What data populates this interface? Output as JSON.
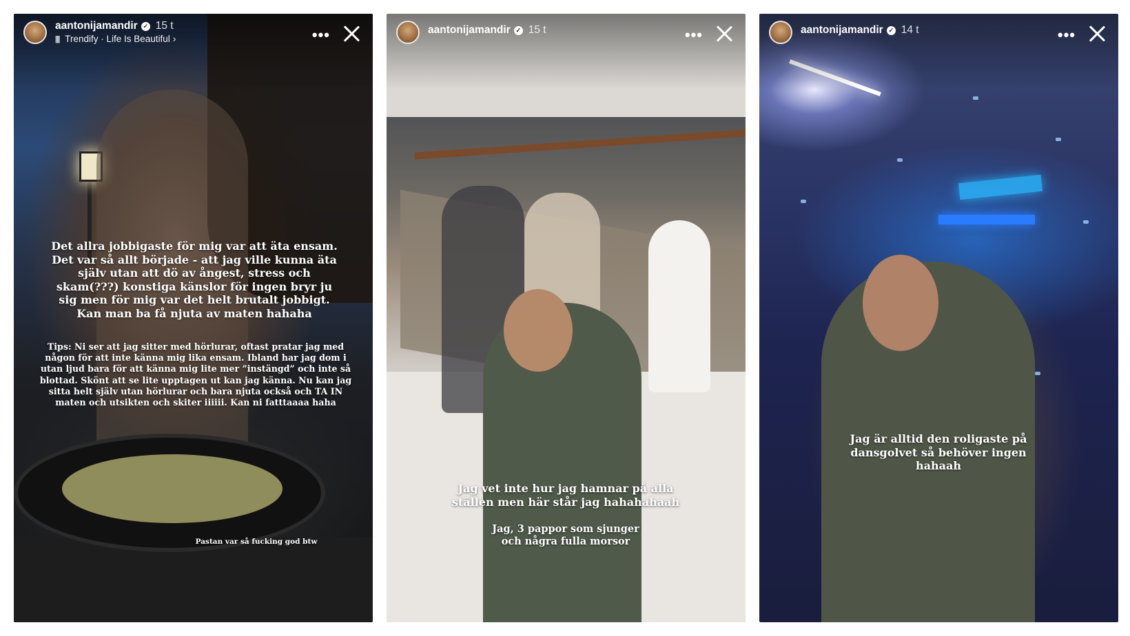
{
  "stories": [
    {
      "username": "aantonijamandir",
      "time": "15 t",
      "music": {
        "label": "Trendify · Life Is Beautiful",
        "icon": "music-bars-icon"
      },
      "captions": {
        "main": "Det allra jobbigaste för mig var att äta ensam. Det var så allt började - att jag ville kunna äta själv utan att dö av ångest, stress och skam(???) konstiga känslor för ingen bryr ju sig men för mig var det helt brutalt jobbigt. Kan man ba få njuta av maten hahaha",
        "tips": "Tips: Ni ser att jag sitter med hörlurar, oftast pratar jag med någon för att inte känna mig lika ensam. Ibland har jag dom i utan ljud bara för att känna mig lite mer ”instängd” och inte så blottad. Skönt att se lite upptagen ut kan jag känna. Nu kan jag sitta helt själv utan hörlurar och bara njuta också och TA IN maten och utsikten och skiter iiiiii. Kan ni fatttaaaa haha",
        "footnote": "Pastan var så fucking god btw"
      }
    },
    {
      "username": "aantonijamandir",
      "time": "15 t",
      "captions": {
        "main": "Jag vet inte hur jag hamnar på alla ställen men här står jag hahahahaah",
        "sub": "Jag, 3 pappor som sjunger och några fulla morsor"
      }
    },
    {
      "username": "aantonijamandir",
      "time": "14 t",
      "captions": {
        "main": "Jag är alltid den roligaste på dansgolvet så behöver ingen hahaah"
      }
    }
  ],
  "icons": {
    "more": "more-dots-icon",
    "close": "close-icon",
    "verified": "verified-badge-icon"
  },
  "glyphs": {
    "more": "•••",
    "verified": "✓",
    "music": "|||",
    "chevron": "›"
  }
}
